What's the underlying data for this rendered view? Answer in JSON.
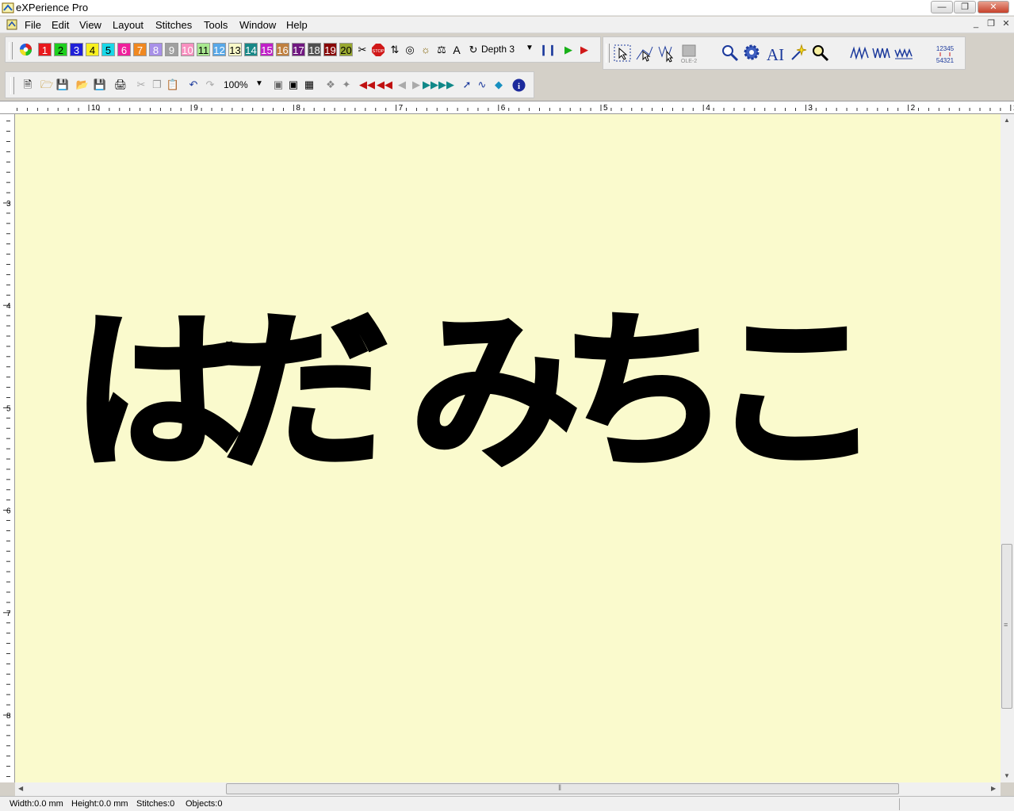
{
  "window": {
    "title": "eXPerience Pro"
  },
  "menu": [
    "File",
    "Edit",
    "View",
    "Layout",
    "Stitches",
    "Tools",
    "Window",
    "Help"
  ],
  "toolbar": {
    "colors": [
      {
        "n": "1",
        "bg": "#e8181c",
        "fg": "#ffffff"
      },
      {
        "n": "2",
        "bg": "#1fcf1f",
        "fg": "#000000"
      },
      {
        "n": "3",
        "bg": "#2020d8",
        "fg": "#ffffff"
      },
      {
        "n": "4",
        "bg": "#f8f020",
        "fg": "#000000"
      },
      {
        "n": "5",
        "bg": "#18d8e8",
        "fg": "#000000"
      },
      {
        "n": "6",
        "bg": "#f0209c",
        "fg": "#ffffff"
      },
      {
        "n": "7",
        "bg": "#f08820",
        "fg": "#ffffff"
      },
      {
        "n": "8",
        "bg": "#a890e8",
        "fg": "#ffffff"
      },
      {
        "n": "9",
        "bg": "#a0a0a0",
        "fg": "#ffffff"
      },
      {
        "n": "10",
        "bg": "#f890c0",
        "fg": "#ffffff"
      },
      {
        "n": "11",
        "bg": "#a8e890",
        "fg": "#000000"
      },
      {
        "n": "12",
        "bg": "#58a8e8",
        "fg": "#ffffff"
      },
      {
        "n": "13",
        "bg": "#f8f8c8",
        "fg": "#000000"
      },
      {
        "n": "14",
        "bg": "#188888",
        "fg": "#ffffff"
      },
      {
        "n": "15",
        "bg": "#c020c8",
        "fg": "#ffffff"
      },
      {
        "n": "16",
        "bg": "#c08040",
        "fg": "#ffffff"
      },
      {
        "n": "17",
        "bg": "#701880",
        "fg": "#ffffff"
      },
      {
        "n": "18",
        "bg": "#505050",
        "fg": "#ffffff"
      },
      {
        "n": "19",
        "bg": "#880808",
        "fg": "#ffffff"
      },
      {
        "n": "20",
        "bg": "#98a830",
        "fg": "#000000"
      }
    ],
    "depth_label": "Depth 3",
    "zoom": "100%",
    "ole_label": "OLE-2",
    "ai_label": "AI",
    "seq_top": "12345",
    "seq_bottom": "54321"
  },
  "ruler": {
    "top": [
      "10",
      "9",
      "8",
      "7",
      "6",
      "5",
      "4",
      "3",
      "2",
      "1"
    ],
    "left": [
      "3",
      "4",
      "5",
      "6",
      "7",
      "8"
    ]
  },
  "canvas": {
    "text": "はだ みちこ",
    "bg": "#fafacd"
  },
  "status": {
    "width": "Width:0.0 mm",
    "height": "Height:0.0 mm",
    "stitches": "Stitches:0",
    "objects": "Objects:0"
  }
}
